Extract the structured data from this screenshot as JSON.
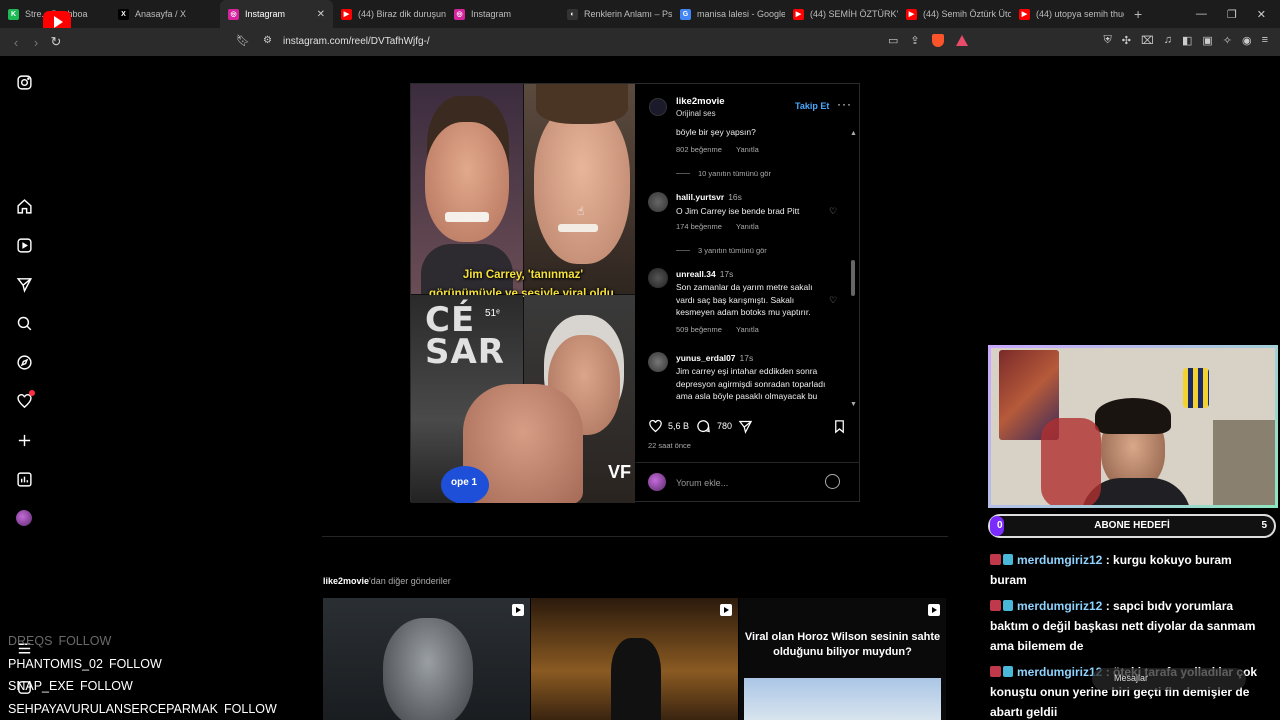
{
  "browser": {
    "tabs": [
      {
        "label": "Stre... Dashboa",
        "fav_color": "#1db954",
        "fav_glyph": "K",
        "active": false
      },
      {
        "label": "Anasayfa / X",
        "fav_color": "#000000",
        "fav_glyph": "X",
        "active": false
      },
      {
        "label": "Instagram",
        "fav_color": "#d6249f",
        "fav_glyph": "◎",
        "active": true
      },
      {
        "label": "(44) Biraz dik duruşun",
        "fav_color": "#ff0000",
        "fav_glyph": "▶",
        "active": false
      },
      {
        "label": "Instagram",
        "fav_color": "#d6249f",
        "fav_glyph": "◎",
        "active": false
      },
      {
        "label": "Renklerin Anlamı – Psik",
        "fav_color": "#333333",
        "fav_glyph": "◐",
        "active": false
      },
      {
        "label": "manisa lalesi - Google",
        "fav_color": "#4285f4",
        "fav_glyph": "G",
        "active": false
      },
      {
        "label": "(44) SEMİH ÖZTÜRK'E",
        "fav_color": "#ff0000",
        "fav_glyph": "▶",
        "active": false
      },
      {
        "label": "(44) Semih Öztürk Ütop",
        "fav_color": "#ff0000",
        "fav_glyph": "▶",
        "active": false
      },
      {
        "label": "(44) utopya semih thug",
        "fav_color": "#ff0000",
        "fav_glyph": "▶",
        "active": false
      }
    ],
    "new_tab": "+",
    "url": "instagram.com/reel/DVTafhWjfg-/"
  },
  "reel": {
    "author": "like2movie",
    "audio": "Orijinal ses",
    "follow_label": "Takip Et",
    "more_label": "···",
    "video_caption_line1": "Jim Carrey, 'tanınmaz'",
    "video_caption_line2": "görünümüyle ve sesiyle viral oldu.",
    "video_cesar": "CÉ\nSAR",
    "video_cesar_small": "51ᵉ",
    "video_vf": "VF",
    "video_mic": "ope 1",
    "comments": {
      "c0_text": "böyle bir şey yapsın?",
      "c0_likes": "802 beğenme",
      "c0_reply": "Yanıtla",
      "c0_view_replies": "10 yanıtın tümünü gör",
      "c1_user": "halil.yurtsvr",
      "c1_time": "16s",
      "c1_text": "O Jim Carrey ise bende brad Pitt",
      "c1_likes": "174 beğenme",
      "c1_reply": "Yanıtla",
      "c1_view_replies": "3 yanıtın tümünü gör",
      "c2_user": "unreall.34",
      "c2_time": "17s",
      "c2_text": "Son zamanlar da yarım metre sakalı vardı saç baş karışmıştı. Sakalı kesmeyen adam botoks mu yaptırır.",
      "c2_likes": "509 beğenme",
      "c2_reply": "Yanıtla",
      "c3_user": "yunus_erdal07",
      "c3_time": "17s",
      "c3_text": "Jim carrey eşi intahar eddikden sonra depresyon agirmişdi sonradan toparladı ama asla böyle pasaklı olmayacak bu başka bir"
    },
    "like_count": "5,6 B",
    "comment_count": "780",
    "posted_ago": "22 saat önce",
    "comment_placeholder": "Yorum ekle..."
  },
  "more_posts": {
    "heading_user": "like2movie",
    "heading_suffix": "'dan diğer gönderiler",
    "third_thumb_text": "Viral olan Horoz Wilson sesinin sahte olduğunu biliyor muydun?"
  },
  "stream": {
    "goal_left": "0",
    "goal_label": "ABONE HEDEFİ",
    "goal_right": "5",
    "goal_progress": 0.04,
    "chat": [
      {
        "user": "merdumgiriz12",
        "text": " : kurgu kokuyo buram buram"
      },
      {
        "user": "merdumgiriz12",
        "text": " : sapci bıdv yorumlara baktım o değil başkası nett diyolar da sanmam ama bilemem de"
      },
      {
        "user": "merdumgiriz12",
        "text": " : öteki tarafa yolladılar çok konuştu onun yerine biri geçti fln demişler de abartı geldii"
      }
    ],
    "messages_label": "Mesajlar",
    "follows": [
      {
        "name": "DREQS",
        "action": "FOLLOW",
        "faded": true
      },
      {
        "name": "PHANTOMIS_02",
        "action": "FOLLOW",
        "faded": false
      },
      {
        "name": "SNAP_EXE",
        "action": "FOLLOW",
        "faded": false
      },
      {
        "name": "SEHPAYAVURULANSERCEPARMAK",
        "action": "FOLLOW",
        "faded": false
      }
    ]
  },
  "colors": {
    "accent_blue": "#4aa8ff",
    "goal_purple": "#7a2cff",
    "notification_red": "#ff3040"
  }
}
